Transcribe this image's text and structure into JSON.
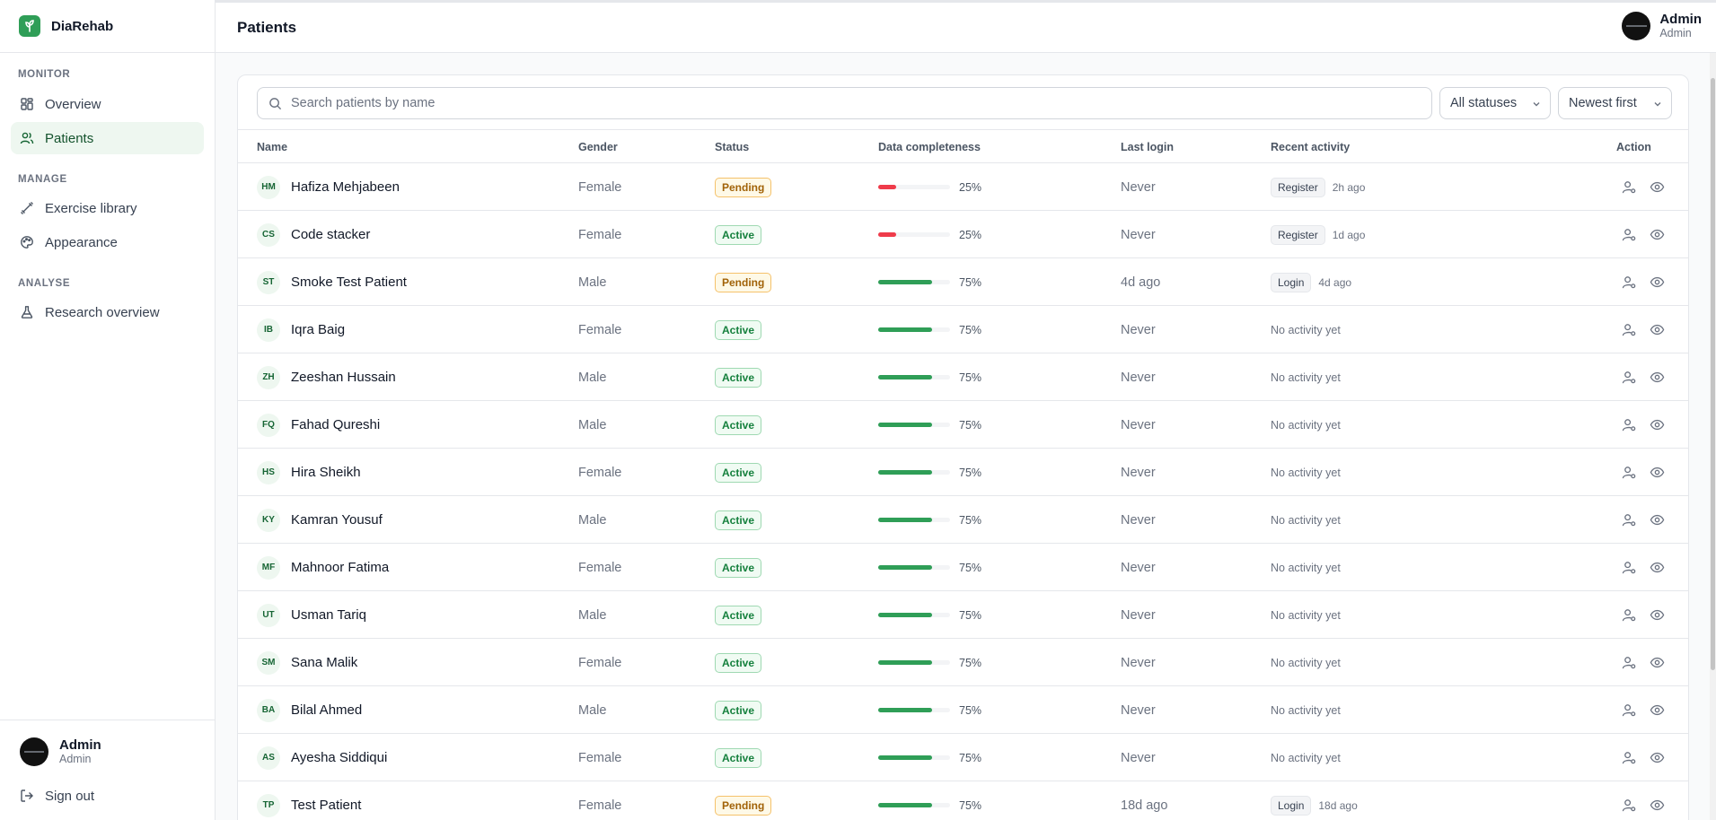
{
  "app": {
    "name": "DiaRehab",
    "brand_color": "#2f9e57"
  },
  "sidebar": {
    "sections": [
      {
        "label": "MONITOR",
        "items": [
          {
            "label": "Overview",
            "icon": "grid-icon"
          },
          {
            "label": "Patients",
            "icon": "users-icon",
            "active": true
          }
        ]
      },
      {
        "label": "MANAGE",
        "items": [
          {
            "label": "Exercise library",
            "icon": "dumbbell-icon"
          },
          {
            "label": "Appearance",
            "icon": "palette-icon"
          }
        ]
      },
      {
        "label": "ANALYSE",
        "items": [
          {
            "label": "Research overview",
            "icon": "flask-icon"
          }
        ]
      }
    ],
    "user": {
      "name": "Admin",
      "role": "Admin"
    },
    "sign_out": "Sign out"
  },
  "header": {
    "title": "Patients",
    "user": {
      "name": "Admin",
      "role": "Admin"
    }
  },
  "filters": {
    "search_placeholder": "Search patients by name",
    "status_select": "All statuses",
    "sort_select": "Newest first"
  },
  "table": {
    "columns": [
      "Name",
      "Gender",
      "Status",
      "Data completeness",
      "Last login",
      "Recent activity",
      "Action"
    ],
    "rows": [
      {
        "initials": "HM",
        "name": "Hafiza Mehjabeen",
        "gender": "Female",
        "status": "Pending",
        "completeness": 25,
        "completeness_label": "25%",
        "last_login": "Never",
        "activity": "Register",
        "activity_time": "2h ago"
      },
      {
        "initials": "CS",
        "name": "Code stacker",
        "gender": "Female",
        "status": "Active",
        "completeness": 25,
        "completeness_label": "25%",
        "last_login": "Never",
        "activity": "Register",
        "activity_time": "1d ago"
      },
      {
        "initials": "ST",
        "name": "Smoke Test Patient",
        "gender": "Male",
        "status": "Pending",
        "completeness": 75,
        "completeness_label": "75%",
        "last_login": "4d ago",
        "activity": "Login",
        "activity_time": "4d ago"
      },
      {
        "initials": "IB",
        "name": "Iqra Baig",
        "gender": "Female",
        "status": "Active",
        "completeness": 75,
        "completeness_label": "75%",
        "last_login": "Never",
        "activity": "",
        "activity_time": "",
        "no_activity": "No activity yet"
      },
      {
        "initials": "ZH",
        "name": "Zeeshan Hussain",
        "gender": "Male",
        "status": "Active",
        "completeness": 75,
        "completeness_label": "75%",
        "last_login": "Never",
        "activity": "",
        "activity_time": "",
        "no_activity": "No activity yet"
      },
      {
        "initials": "FQ",
        "name": "Fahad Qureshi",
        "gender": "Male",
        "status": "Active",
        "completeness": 75,
        "completeness_label": "75%",
        "last_login": "Never",
        "activity": "",
        "activity_time": "",
        "no_activity": "No activity yet"
      },
      {
        "initials": "HS",
        "name": "Hira Sheikh",
        "gender": "Female",
        "status": "Active",
        "completeness": 75,
        "completeness_label": "75%",
        "last_login": "Never",
        "activity": "",
        "activity_time": "",
        "no_activity": "No activity yet"
      },
      {
        "initials": "KY",
        "name": "Kamran Yousuf",
        "gender": "Male",
        "status": "Active",
        "completeness": 75,
        "completeness_label": "75%",
        "last_login": "Never",
        "activity": "",
        "activity_time": "",
        "no_activity": "No activity yet"
      },
      {
        "initials": "MF",
        "name": "Mahnoor Fatima",
        "gender": "Female",
        "status": "Active",
        "completeness": 75,
        "completeness_label": "75%",
        "last_login": "Never",
        "activity": "",
        "activity_time": "",
        "no_activity": "No activity yet"
      },
      {
        "initials": "UT",
        "name": "Usman Tariq",
        "gender": "Male",
        "status": "Active",
        "completeness": 75,
        "completeness_label": "75%",
        "last_login": "Never",
        "activity": "",
        "activity_time": "",
        "no_activity": "No activity yet"
      },
      {
        "initials": "SM",
        "name": "Sana Malik",
        "gender": "Female",
        "status": "Active",
        "completeness": 75,
        "completeness_label": "75%",
        "last_login": "Never",
        "activity": "",
        "activity_time": "",
        "no_activity": "No activity yet"
      },
      {
        "initials": "BA",
        "name": "Bilal Ahmed",
        "gender": "Male",
        "status": "Active",
        "completeness": 75,
        "completeness_label": "75%",
        "last_login": "Never",
        "activity": "",
        "activity_time": "",
        "no_activity": "No activity yet"
      },
      {
        "initials": "AS",
        "name": "Ayesha Siddiqui",
        "gender": "Female",
        "status": "Active",
        "completeness": 75,
        "completeness_label": "75%",
        "last_login": "Never",
        "activity": "",
        "activity_time": "",
        "no_activity": "No activity yet"
      },
      {
        "initials": "TP",
        "name": "Test Patient",
        "gender": "Female",
        "status": "Pending",
        "completeness": 75,
        "completeness_label": "75%",
        "last_login": "18d ago",
        "activity": "Login",
        "activity_time": "18d ago"
      }
    ]
  },
  "colors": {
    "low_completeness": "#ef3b4a",
    "good_completeness": "#2f9e57"
  }
}
